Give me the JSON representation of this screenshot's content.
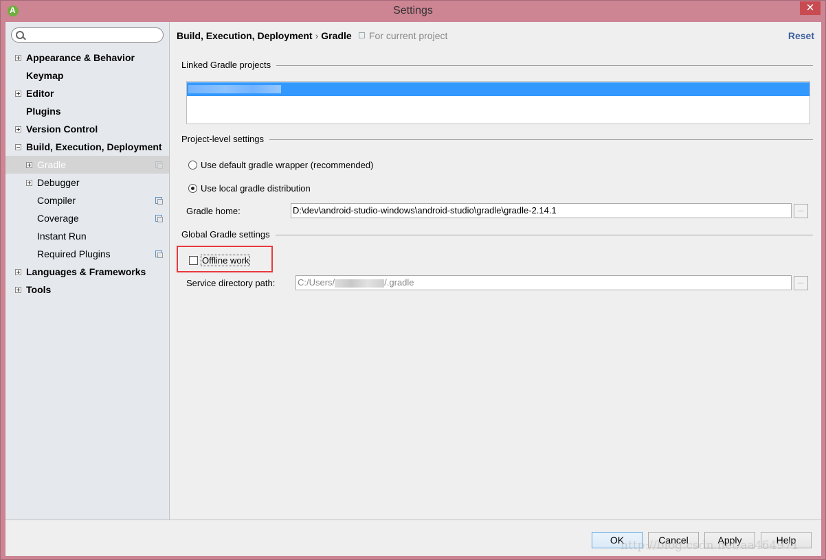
{
  "window": {
    "title": "Settings",
    "close_label": "✕",
    "frame_color": "#cd8493"
  },
  "sidebar": {
    "search": {
      "value": "",
      "placeholder": ""
    },
    "items": [
      {
        "label": "Appearance & Behavior",
        "level": 0,
        "bold": true,
        "expander": "plus"
      },
      {
        "label": "Keymap",
        "level": 0,
        "bold": true,
        "expander": "none"
      },
      {
        "label": "Editor",
        "level": 0,
        "bold": true,
        "expander": "plus"
      },
      {
        "label": "Plugins",
        "level": 0,
        "bold": true,
        "expander": "none"
      },
      {
        "label": "Version Control",
        "level": 0,
        "bold": true,
        "expander": "plus"
      },
      {
        "label": "Build, Execution, Deployment",
        "level": 0,
        "bold": true,
        "expander": "minus"
      },
      {
        "label": "Gradle",
        "level": 1,
        "bold": false,
        "expander": "plus",
        "selected": true,
        "project_icon": true
      },
      {
        "label": "Debugger",
        "level": 1,
        "bold": false,
        "expander": "plus"
      },
      {
        "label": "Compiler",
        "level": 1,
        "bold": false,
        "expander": "none",
        "project_icon": true
      },
      {
        "label": "Coverage",
        "level": 1,
        "bold": false,
        "expander": "none",
        "project_icon": true
      },
      {
        "label": "Instant Run",
        "level": 1,
        "bold": false,
        "expander": "none"
      },
      {
        "label": "Required Plugins",
        "level": 1,
        "bold": false,
        "expander": "none",
        "project_icon": true
      },
      {
        "label": "Languages & Frameworks",
        "level": 0,
        "bold": true,
        "expander": "plus"
      },
      {
        "label": "Tools",
        "level": 0,
        "bold": true,
        "expander": "plus"
      }
    ]
  },
  "header": {
    "breadcrumb": [
      "Build, Execution, Deployment",
      "Gradle"
    ],
    "breadcrumb_sep": "›",
    "scope": "For current project",
    "reset_label": "Reset"
  },
  "linked_projects": {
    "title": "Linked Gradle projects",
    "selected_color": "#3399ff"
  },
  "project_settings": {
    "title": "Project-level settings",
    "radio_default_wrapper": {
      "label": "Use default gradle wrapper (recommended)",
      "checked": false
    },
    "radio_local_distribution": {
      "label": "Use local gradle distribution",
      "checked": true
    },
    "gradle_home_label": "Gradle home:",
    "gradle_home_value": "D:\\dev\\android-studio-windows\\android-studio\\gradle\\gradle-2.14.1",
    "browse_label": "..."
  },
  "global_settings": {
    "title": "Global Gradle settings",
    "offline_work": {
      "label": "Offline work",
      "checked": false
    },
    "highlight_color": "#e8393d",
    "service_dir_label": "Service directory path:",
    "service_dir_prefix": "C:/Users/",
    "service_dir_suffix": "/.gradle",
    "browse_label": "..."
  },
  "footer": {
    "ok": "OK",
    "cancel": "Cancel",
    "apply": "Apply",
    "help": "Help",
    "watermark": "http://blog.csdn.net/aa464971"
  }
}
